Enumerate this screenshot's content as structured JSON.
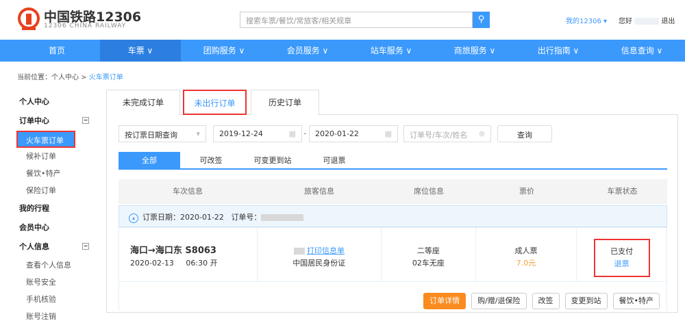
{
  "header": {
    "logo_cn": "中国铁路12306",
    "logo_en": "12306 CHINA RAILWAY",
    "search_placeholder": "搜索车票/餐饮/常旅客/相关规章",
    "my12306": "我的12306 ▾",
    "greeting": "您好",
    "logout": "退出",
    "brand_color": "#3b99fc"
  },
  "nav": [
    {
      "label": "首页"
    },
    {
      "label": "车票 ∨"
    },
    {
      "label": "团购服务 ∨"
    },
    {
      "label": "会员服务 ∨"
    },
    {
      "label": "站车服务 ∨"
    },
    {
      "label": "商旅服务 ∨"
    },
    {
      "label": "出行指南 ∨"
    },
    {
      "label": "信息查询 ∨"
    }
  ],
  "breadcrumb": {
    "prefix": "当前位置：个人中心 > ",
    "current": "火车票订单"
  },
  "sidebar": {
    "personal_center": "个人中心",
    "order_center": "订单中心",
    "orders": [
      "火车票订单",
      "候补订单",
      "餐饮•特产",
      "保险订单"
    ],
    "my_trips": "我的行程",
    "member_center": "会员中心",
    "personal_info": "个人信息",
    "info_items": [
      "查看个人信息",
      "账号安全",
      "手机核验",
      "账号注销"
    ]
  },
  "tabs": [
    "未完成订单",
    "未出行订单",
    "历史订单"
  ],
  "filter": {
    "mode": "按订票日期查询",
    "start": "2019-12-24",
    "end": "2020-01-22",
    "placeholder": "订单号/车次/姓名",
    "query": "查询"
  },
  "subtabs": [
    "全部",
    "可改签",
    "可变更到站",
    "可退票"
  ],
  "table": {
    "headers": [
      "车次信息",
      "旅客信息",
      "席位信息",
      "票价",
      "车票状态"
    ]
  },
  "order": {
    "date_label": "订票日期：",
    "date": "2020-01-22",
    "no_label": "订单号：",
    "route": "海口→海口东 S8063",
    "dep_date": "2020-02-13",
    "dep_time": "06:30 开",
    "print": "打印信息单",
    "id_type": "中国居民身份证",
    "seat_class": "二等座",
    "seat": "02车无座",
    "ticket_type": "成人票",
    "price": "7.0元",
    "status": "已支付",
    "refund": "退票"
  },
  "actions": [
    "订单详情",
    "购/赠/退保险",
    "改签",
    "变更到站",
    "餐饮•特产"
  ]
}
